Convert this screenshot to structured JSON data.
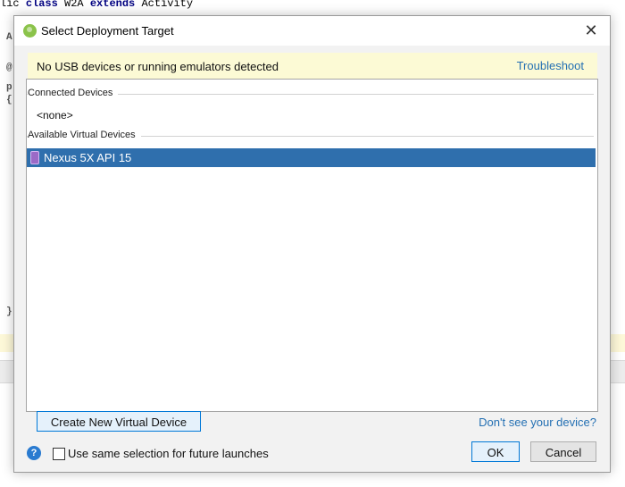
{
  "editor": {
    "code_first_line_prefix": "lic ",
    "kw_class": "class",
    "class_name": " W2A ",
    "kw_extends": "extends",
    "parent_class": " Activity",
    "gutter_chars": [
      "A",
      "@",
      "p",
      "{",
      "}"
    ]
  },
  "dialog": {
    "title": "Select Deployment Target",
    "banner": {
      "message": "No USB devices or running emulators detected",
      "link": "Troubleshoot"
    },
    "connected_devices": {
      "header": "Connected Devices",
      "empty_label": "<none>"
    },
    "available_virtual_devices": {
      "header": "Available Virtual Devices",
      "items": [
        {
          "label": "Nexus 5X API 15",
          "selected": true
        }
      ]
    },
    "create_button": "Create New Virtual Device",
    "dont_see_link": "Don't see your device?",
    "checkbox_label": "Use same selection for future launches",
    "ok_button": "OK",
    "cancel_button": "Cancel"
  },
  "icons": {
    "title_icon": "android-studio-icon",
    "close_icon": "close-icon",
    "device_icon": "phone-icon",
    "help_icon": "help-icon"
  },
  "colors": {
    "selection": "#2f6fad",
    "banner_bg": "#fcfad5",
    "link": "#2470b3",
    "primary_border": "#0078d7"
  }
}
